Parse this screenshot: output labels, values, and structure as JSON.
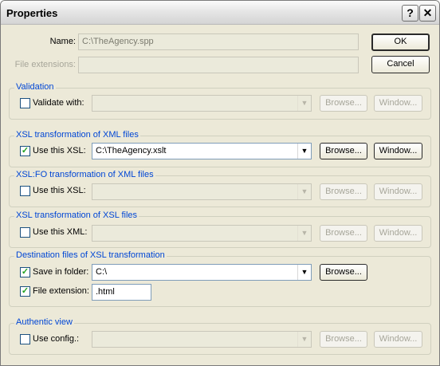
{
  "window": {
    "title": "Properties",
    "help_button": "?",
    "close_button": "✕"
  },
  "name_row": {
    "label": "Name:",
    "value": "C:\\TheAgency.spp"
  },
  "ext_row": {
    "label": "File extensions:",
    "value": ""
  },
  "dialog_buttons": {
    "ok": "OK",
    "cancel": "Cancel"
  },
  "validation": {
    "title": "Validation",
    "checkbox_label": "Validate with:",
    "checked": false,
    "value": "",
    "browse": "Browse...",
    "window": "Window..."
  },
  "xsl_xml": {
    "title": "XSL transformation of XML files",
    "checkbox_label": "Use this XSL:",
    "checked": true,
    "value": "C:\\TheAgency.xslt",
    "browse": "Browse...",
    "window": "Window..."
  },
  "xslfo": {
    "title": "XSL:FO transformation of XML files",
    "checkbox_label": "Use this XSL:",
    "checked": false,
    "value": "",
    "browse": "Browse...",
    "window": "Window..."
  },
  "xsl_xsl": {
    "title": "XSL transformation of XSL files",
    "checkbox_label": "Use this XML:",
    "checked": false,
    "value": "",
    "browse": "Browse...",
    "window": "Window..."
  },
  "destination": {
    "title": "Destination files of XSL transformation",
    "folder_label": "Save in folder:",
    "folder_checked": true,
    "folder_value": "C:\\",
    "browse": "Browse...",
    "ext_label": "File extension:",
    "ext_checked": true,
    "ext_value": ".html"
  },
  "authentic": {
    "title": "Authentic view",
    "checkbox_label": "Use config.:",
    "checked": false,
    "value": "",
    "browse": "Browse...",
    "window": "Window..."
  },
  "icons": {
    "check_glyph": "✓",
    "arrow_glyph": "▼"
  }
}
